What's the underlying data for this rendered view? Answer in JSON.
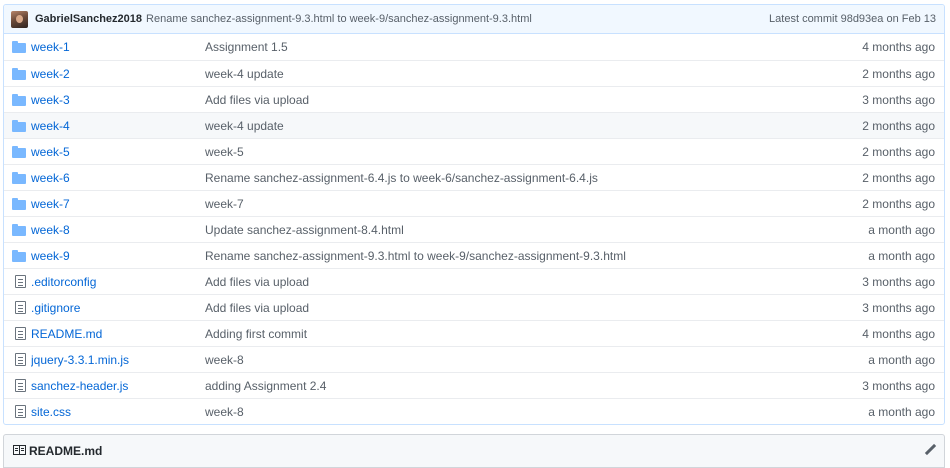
{
  "commit": {
    "author": "GabrielSanchez2018",
    "message": "Rename sanchez-assignment-9.3.html to week-9/sanchez-assignment-9.3.html",
    "latest_label": "Latest commit ",
    "sha": "98d93ea",
    "date": " on Feb 13"
  },
  "files": [
    {
      "type": "folder",
      "name": "week-1",
      "message": "Assignment 1.5",
      "age": "4 months ago"
    },
    {
      "type": "folder",
      "name": "week-2",
      "message": "week-4 update",
      "age": "2 months ago"
    },
    {
      "type": "folder",
      "name": "week-3",
      "message": "Add files via upload",
      "age": "3 months ago"
    },
    {
      "type": "folder",
      "name": "week-4",
      "message": "week-4 update",
      "age": "2 months ago"
    },
    {
      "type": "folder",
      "name": "week-5",
      "message": "week-5",
      "age": "2 months ago"
    },
    {
      "type": "folder",
      "name": "week-6",
      "message": "Rename sanchez-assignment-6.4.js to week-6/sanchez-assignment-6.4.js",
      "age": "2 months ago"
    },
    {
      "type": "folder",
      "name": "week-7",
      "message": "week-7",
      "age": "2 months ago"
    },
    {
      "type": "folder",
      "name": "week-8",
      "message": "Update sanchez-assignment-8.4.html",
      "age": "a month ago"
    },
    {
      "type": "folder",
      "name": "week-9",
      "message": "Rename sanchez-assignment-9.3.html to week-9/sanchez-assignment-9.3.html",
      "age": "a month ago"
    },
    {
      "type": "file",
      "name": ".editorconfig",
      "message": "Add files via upload",
      "age": "3 months ago"
    },
    {
      "type": "file",
      "name": ".gitignore",
      "message": "Add files via upload",
      "age": "3 months ago"
    },
    {
      "type": "file",
      "name": "README.md",
      "message": "Adding first commit",
      "age": "4 months ago"
    },
    {
      "type": "file",
      "name": "jquery-3.3.1.min.js",
      "message": "week-8",
      "age": "a month ago"
    },
    {
      "type": "file",
      "name": "sanchez-header.js",
      "message": "adding Assignment 2.4",
      "age": "3 months ago"
    },
    {
      "type": "file",
      "name": "site.css",
      "message": "week-8",
      "age": "a month ago"
    }
  ],
  "highlighted_row": "week-4",
  "readme": {
    "title": "README.md",
    "icon": "book-icon",
    "edit_icon": "pencil-icon"
  },
  "colors": {
    "link": "#0366d6",
    "folder": "#79b8ff",
    "commit_bar_bg": "#f1f8ff",
    "muted": "#586069"
  }
}
